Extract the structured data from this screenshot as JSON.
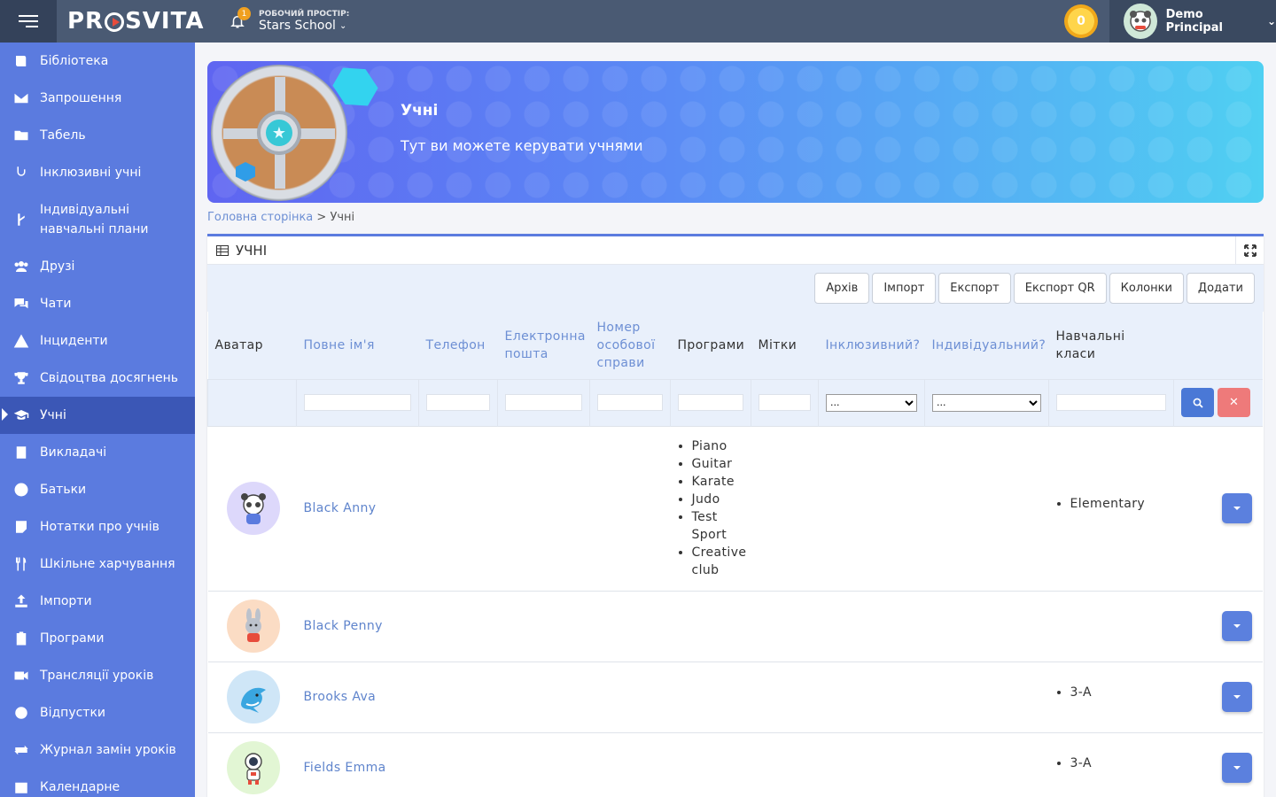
{
  "app": {
    "logo_pre": "PR",
    "logo_post": "SVITA"
  },
  "topbar": {
    "notifications_count": "1",
    "workspace_label": "РОБОЧИЙ ПРОСТІР:",
    "workspace_name": "Stars School",
    "coins": "0",
    "user_name": "Demo Principal"
  },
  "sidebar": {
    "items": [
      {
        "label": "Бібліотека",
        "icon": "book-icon"
      },
      {
        "label": "Запрошення",
        "icon": "envelope-icon"
      },
      {
        "label": "Табель",
        "icon": "folder-icon"
      },
      {
        "label": "Інклюзивні учні",
        "icon": "hands-icon"
      },
      {
        "label": "Індивідуальні навчальні плани",
        "icon": "route-icon"
      },
      {
        "label": "Друзі",
        "icon": "users-icon"
      },
      {
        "label": "Чати",
        "icon": "comments-icon"
      },
      {
        "label": "Інциденти",
        "icon": "warning-icon"
      },
      {
        "label": "Свідоцтва досягнень",
        "icon": "trophy-icon"
      },
      {
        "label": "Учні",
        "icon": "graduation-cap-icon",
        "active": true
      },
      {
        "label": "Викладачі",
        "icon": "teacher-icon"
      },
      {
        "label": "Батьки",
        "icon": "user-circle-icon"
      },
      {
        "label": "Нотатки про учнів",
        "icon": "note-icon"
      },
      {
        "label": "Шкільне харчування",
        "icon": "utensils-icon"
      },
      {
        "label": "Імпорти",
        "icon": "upload-icon"
      },
      {
        "label": "Програми",
        "icon": "clipboard-icon"
      },
      {
        "label": "Трансляції уроків",
        "icon": "video-icon"
      },
      {
        "label": "Відпустки",
        "icon": "circle-icon"
      },
      {
        "label": "Журнал замін уроків",
        "icon": "exchange-icon"
      },
      {
        "label": "Календарне",
        "icon": "calendar-icon"
      }
    ]
  },
  "banner": {
    "title": "Учні",
    "subtitle": "Тут ви можете керувати учнями"
  },
  "breadcrumb": {
    "home": "Головна сторінка",
    "sep": " > ",
    "current": "Учні"
  },
  "panel": {
    "title": "УЧНІ",
    "buttons": [
      "Архів",
      "Імпорт",
      "Експорт",
      "Експорт QR",
      "Колонки",
      "Додати"
    ]
  },
  "table": {
    "headers": [
      {
        "label": "Аватар",
        "link": false
      },
      {
        "label": "Повне ім'я",
        "link": true
      },
      {
        "label": "Телефон",
        "link": true
      },
      {
        "label": "Електронна пошта",
        "link": true
      },
      {
        "label": "Номер особової справи",
        "link": true
      },
      {
        "label": "Програми",
        "link": false
      },
      {
        "label": "Мітки",
        "link": false
      },
      {
        "label": "Інклюзивний?",
        "link": true
      },
      {
        "label": "Індивідуальний?",
        "link": true
      },
      {
        "label": "Навчальні класи",
        "link": false
      }
    ],
    "select_placeholder": "...",
    "rows": [
      {
        "name": "Black Anny",
        "avatar": "panda-avatar",
        "programs": [
          "Piano",
          "Guitar",
          "Karate",
          "Judo",
          "Test Sport",
          "Creative club"
        ],
        "classes": [
          "Elementary"
        ]
      },
      {
        "name": "Black Penny",
        "avatar": "bunny-avatar",
        "programs": [],
        "classes": []
      },
      {
        "name": "Brooks Ava",
        "avatar": "shark-avatar",
        "programs": [],
        "classes": [
          "3-A"
        ]
      },
      {
        "name": "Fields Emma",
        "avatar": "astronaut-avatar",
        "programs": [],
        "classes": [
          "3-A"
        ]
      }
    ]
  }
}
